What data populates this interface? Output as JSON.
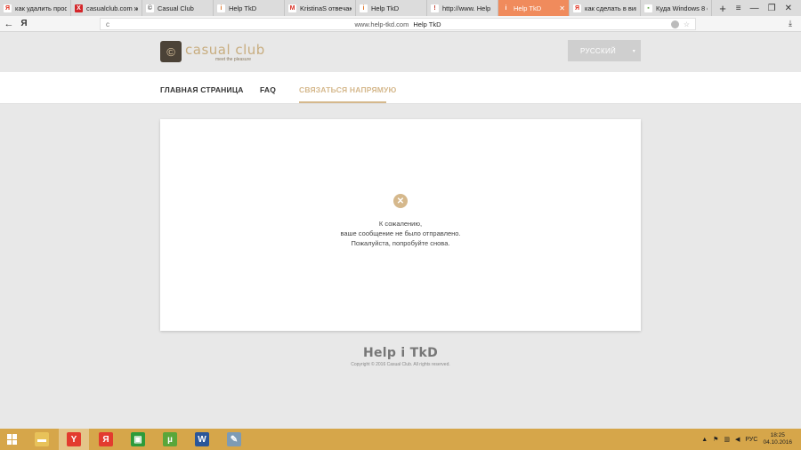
{
  "browser": {
    "tabs": [
      {
        "label": "как удалить проф",
        "favicon": "Я",
        "fav_bg": "#ffffff",
        "fav_color": "#e0301e",
        "active": false
      },
      {
        "label": "casualclub.com ж",
        "favicon": "X",
        "fav_bg": "#d4262a",
        "fav_color": "#ffffff",
        "active": false
      },
      {
        "label": "Casual Club",
        "favicon": "©",
        "fav_bg": "#ffffff",
        "fav_color": "#555555",
        "active": false
      },
      {
        "label": "Help TkD",
        "favicon": "i",
        "fav_bg": "#ffffff",
        "fav_color": "#e0772c",
        "active": false
      },
      {
        "label": "KristinaS отвечаю",
        "favicon": "M",
        "fav_bg": "#ffffff",
        "fav_color": "#d93025",
        "active": false
      },
      {
        "label": "Help TkD",
        "favicon": "i",
        "fav_bg": "#ffffff",
        "fav_color": "#e0772c",
        "active": false
      },
      {
        "label": "http://www. Help",
        "favicon": "!",
        "fav_bg": "#ffffff",
        "fav_color": "#c0392b",
        "active": false
      },
      {
        "label": "Help TkD",
        "favicon": "i",
        "fav_bg": "#f08b5c",
        "fav_color": "#ffffff",
        "active": true
      },
      {
        "label": "как сделать в вин",
        "favicon": "Я",
        "fav_bg": "#ffffff",
        "fav_color": "#e0301e",
        "active": false
      },
      {
        "label": "Куда Windows 8 с",
        "favicon": "▪",
        "fav_bg": "#ffffff",
        "fav_color": "#6aa84f",
        "active": false
      }
    ],
    "new_tab": "+",
    "window_controls": {
      "menu": "≡",
      "minimize": "—",
      "restore": "❐",
      "close": "✕"
    },
    "back": "←",
    "yandex": "Я",
    "address": {
      "url": "www.help-tkd.com",
      "title": "Help TkD"
    },
    "reload": "c",
    "star": "☆",
    "download": "⤓"
  },
  "site": {
    "logo_glyph": "©",
    "logo_text": "casual club",
    "logo_tagline": "meet the pleasure",
    "language": "РУССКИЙ",
    "caret": "▾",
    "nav": [
      {
        "label": "ГЛАВНАЯ СТРАНИЦА"
      },
      {
        "label": "FAQ"
      },
      {
        "label": "СВЯЗАТЬСЯ НАПРЯМУЮ"
      }
    ]
  },
  "message": {
    "icon": "✕",
    "lines": [
      "К сожалению,",
      "ваше сообщение не было отправлено.",
      "Пожалуйста, попробуйте снова."
    ]
  },
  "footer": {
    "logo": "Help i TkD",
    "copyright": "Copyright © 2016 Casual Club. All rights reserved."
  },
  "taskbar": {
    "apps": [
      {
        "name": "file-explorer-icon",
        "glyph": "▬",
        "bg": "#e8c25a",
        "active": false
      },
      {
        "name": "yandex-browser-icon",
        "glyph": "Y",
        "bg": "#e33b2e",
        "active": true
      },
      {
        "name": "yandex-icon",
        "glyph": "Я",
        "bg": "#e33b2e",
        "active": false
      },
      {
        "name": "store-icon",
        "glyph": "▣",
        "bg": "#2d9b3a",
        "active": false
      },
      {
        "name": "utorrent-icon",
        "glyph": "µ",
        "bg": "#5aa63a",
        "active": false
      },
      {
        "name": "word-icon",
        "glyph": "W",
        "bg": "#2a5699",
        "active": false
      },
      {
        "name": "paint-icon",
        "glyph": "✎",
        "bg": "#7d9bb5",
        "active": false
      }
    ],
    "lang": "РУС",
    "time": "18:25",
    "date": "04.10.2016"
  }
}
